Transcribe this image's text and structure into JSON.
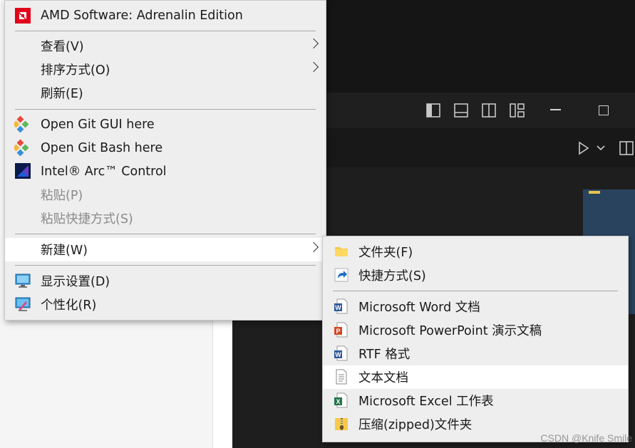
{
  "main_menu": {
    "items": [
      {
        "label": "AMD Software: Adrenalin Edition",
        "icon": "amd-icon"
      },
      {
        "label": "查看(V)",
        "submenu": true
      },
      {
        "label": "排序方式(O)",
        "submenu": true
      },
      {
        "label": "刷新(E)"
      },
      {
        "label": "Open Git GUI here",
        "icon": "git-icon"
      },
      {
        "label": "Open Git Bash here",
        "icon": "git-icon"
      },
      {
        "label": "Intel® Arc™ Control",
        "icon": "intel-arc-icon"
      },
      {
        "label": "粘贴(P)",
        "disabled": true
      },
      {
        "label": "粘贴快捷方式(S)",
        "disabled": true
      },
      {
        "label": "新建(W)",
        "submenu": true,
        "highlighted": true
      },
      {
        "label": "显示设置(D)",
        "icon": "display-icon"
      },
      {
        "label": "个性化(R)",
        "icon": "personalize-icon"
      }
    ]
  },
  "sub_menu": {
    "items": [
      {
        "label": "文件夹(F)",
        "icon": "folder-icon"
      },
      {
        "label": "快捷方式(S)",
        "icon": "shortcut-icon"
      },
      {
        "label": "Microsoft Word 文档",
        "icon": "word-icon"
      },
      {
        "label": "Microsoft PowerPoint 演示文稿",
        "icon": "powerpoint-icon"
      },
      {
        "label": "RTF 格式",
        "icon": "rtf-icon"
      },
      {
        "label": "文本文档",
        "icon": "text-document-icon",
        "highlighted": true
      },
      {
        "label": "Microsoft Excel 工作表",
        "icon": "excel-icon"
      },
      {
        "label": "压缩(zipped)文件夹",
        "icon": "zip-folder-icon"
      }
    ]
  },
  "watermark": "CSDN @Knife Smile",
  "colors": {
    "amd_red": "#e2001a",
    "highlight": "#ffffff",
    "menu_bg": "#eeeeee",
    "dark_bg": "#1e1e1e"
  }
}
